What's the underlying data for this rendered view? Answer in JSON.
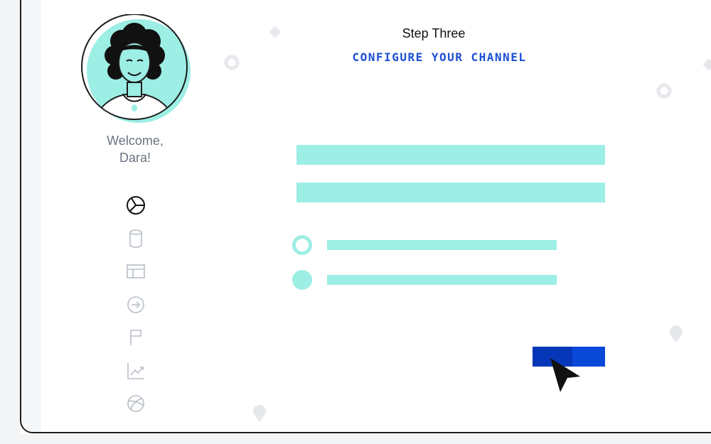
{
  "profile": {
    "welcome_line1": "Welcome,",
    "welcome_line2": "Dara!"
  },
  "nav": {
    "items": [
      {
        "name": "pie-chart-icon",
        "active": true
      },
      {
        "name": "database-icon",
        "active": false
      },
      {
        "name": "table-icon",
        "active": false
      },
      {
        "name": "arrow-circle-icon",
        "active": false
      },
      {
        "name": "flag-icon",
        "active": false
      },
      {
        "name": "trend-chart-icon",
        "active": false
      },
      {
        "name": "globe-icon",
        "active": false
      }
    ]
  },
  "wizard": {
    "step_label": "Step Three",
    "step_title": "CONFIGURE YOUR CHANNEL"
  },
  "colors": {
    "accent": "#1c4fd6",
    "button": "#0a48d8",
    "mint": "#9deee4",
    "muted_text": "#6b7280"
  }
}
